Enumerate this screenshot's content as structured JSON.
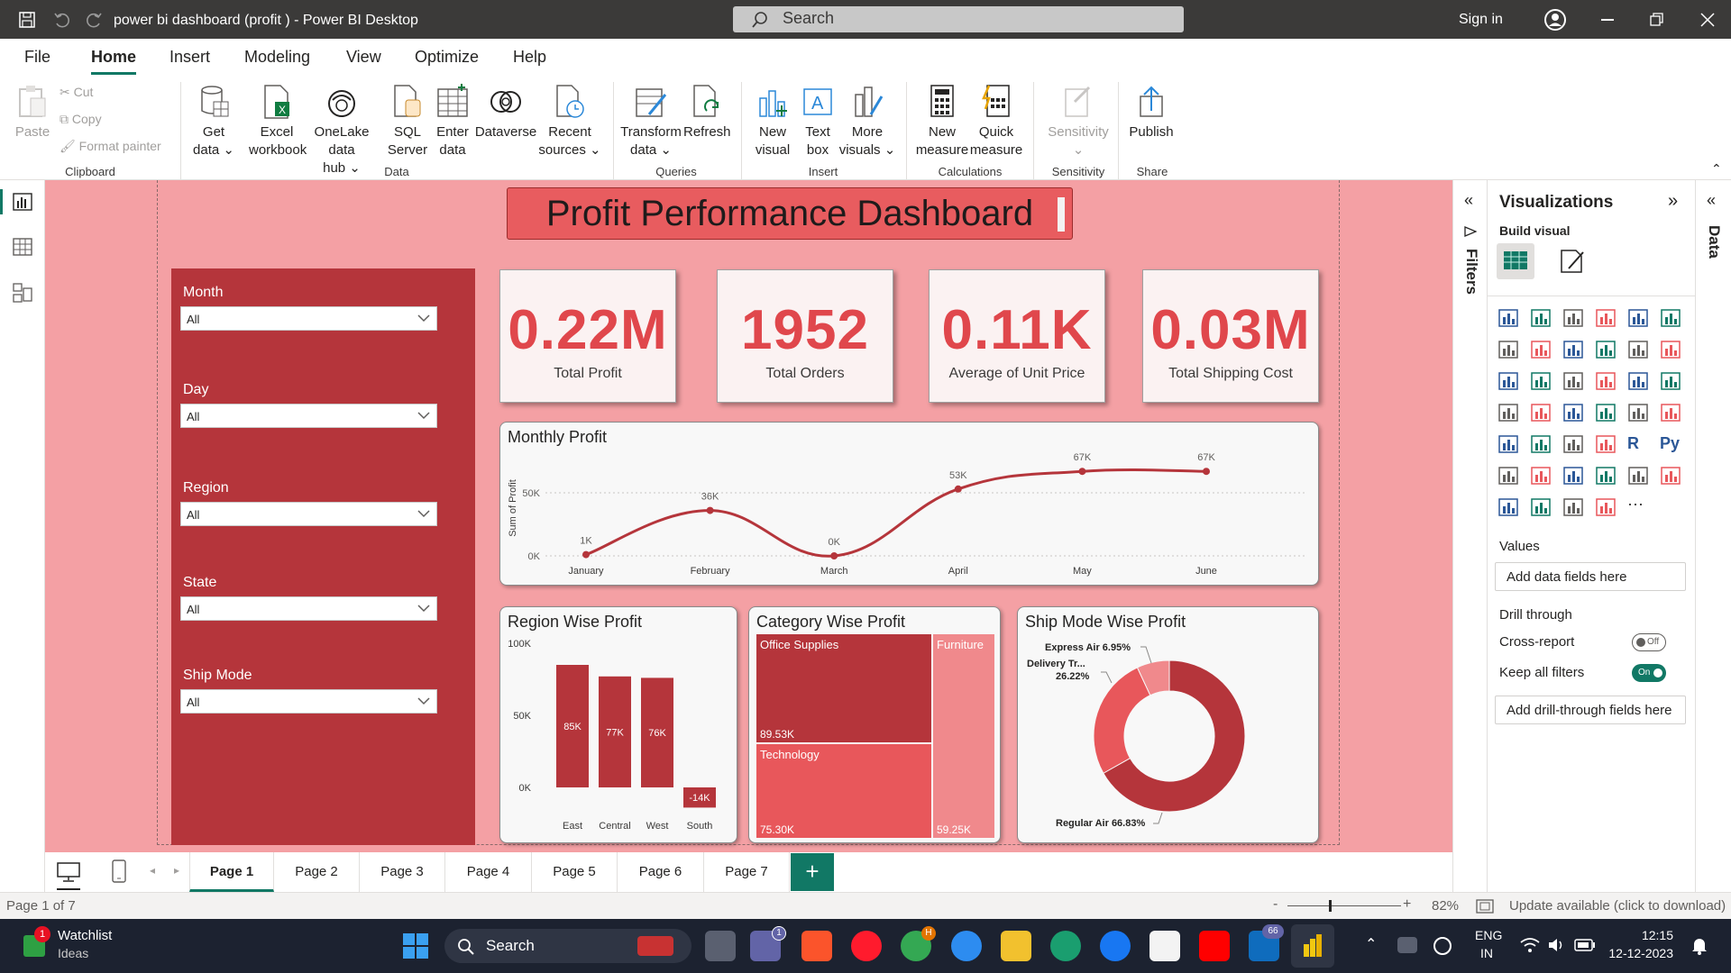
{
  "window": {
    "title": "power bi dashboard (profit ) - Power BI Desktop",
    "search_placeholder": "Search",
    "sign_in": "Sign in"
  },
  "menu": {
    "items": [
      "File",
      "Home",
      "Insert",
      "Modeling",
      "View",
      "Optimize",
      "Help"
    ],
    "active": "Home"
  },
  "ribbon": {
    "clipboard": {
      "paste": "Paste",
      "cut": "Cut",
      "copy": "Copy",
      "format_painter": "Format painter",
      "group": "Clipboard"
    },
    "data": {
      "get_data": [
        "Get",
        "data"
      ],
      "excel": [
        "Excel",
        "workbook"
      ],
      "onelake": [
        "OneLake data",
        "hub"
      ],
      "sql": [
        "SQL",
        "Server"
      ],
      "enter": [
        "Enter",
        "data"
      ],
      "dataverse": "Dataverse",
      "recent": [
        "Recent",
        "sources"
      ],
      "group": "Data"
    },
    "queries": {
      "transform": [
        "Transform",
        "data"
      ],
      "refresh": "Refresh",
      "group": "Queries"
    },
    "insert": {
      "new_visual": [
        "New",
        "visual"
      ],
      "text_box": [
        "Text",
        "box"
      ],
      "more_visuals": [
        "More",
        "visuals"
      ],
      "group": "Insert"
    },
    "calculations": {
      "new_measure": [
        "New",
        "measure"
      ],
      "quick_measure": [
        "Quick",
        "measure"
      ],
      "group": "Calculations"
    },
    "sensitivity": {
      "label": "Sensitivity",
      "group": "Sensitivity"
    },
    "share": {
      "publish": "Publish",
      "group": "Share"
    }
  },
  "dashboard": {
    "title": "Profit Performance Dashboard",
    "slicers": [
      {
        "label": "Month",
        "value": "All"
      },
      {
        "label": "Day",
        "value": "All"
      },
      {
        "label": "Region",
        "value": "All"
      },
      {
        "label": "State",
        "value": "All"
      },
      {
        "label": "Ship Mode",
        "value": "All"
      }
    ],
    "cards": [
      {
        "value": "0.22M",
        "label": "Total Profit"
      },
      {
        "value": "1952",
        "label": "Total Orders"
      },
      {
        "value": "0.11K",
        "label": "Average of Unit Price"
      },
      {
        "value": "0.03M",
        "label": "Total Shipping Cost"
      }
    ],
    "colors": {
      "canvas": "#f4a0a4",
      "accent": "#b5353b",
      "kpi": "#e0474c",
      "line": "#b5353b"
    }
  },
  "chart_data": [
    {
      "type": "line",
      "title": "Monthly Profit",
      "ylabel": "Sum of Profit",
      "categories": [
        "January",
        "February",
        "March",
        "April",
        "May",
        "June"
      ],
      "values": [
        1,
        36,
        0,
        53,
        67,
        67
      ],
      "data_labels": [
        "1K",
        "36K",
        "0K",
        "53K",
        "67K",
        "67K"
      ],
      "yticks": [
        "50K",
        "0K"
      ],
      "ylim": [
        0,
        70
      ],
      "grid": true
    },
    {
      "type": "bar",
      "title": "Region Wise Profit",
      "categories": [
        "East",
        "Central",
        "West",
        "South"
      ],
      "values": [
        85,
        77,
        76,
        -14
      ],
      "data_labels": [
        "85K",
        "77K",
        "76K",
        "-14K"
      ],
      "yticks": [
        "100K",
        "50K",
        "0K"
      ],
      "ylim": [
        -20,
        100
      ]
    },
    {
      "type": "heatmap",
      "title": "Category Wise Profit",
      "items": [
        {
          "name": "Office Supplies",
          "label": "89.53K",
          "value": 89.53
        },
        {
          "name": "Technology",
          "label": "75.30K",
          "value": 75.3
        },
        {
          "name": "Furniture",
          "label": "59.25K",
          "value": 59.25
        }
      ]
    },
    {
      "type": "pie",
      "title": "Ship Mode Wise Profit",
      "slices": [
        {
          "name": "Regular Air",
          "value": 66.83,
          "label": "Regular Air 66.83%",
          "color": "#b5353b"
        },
        {
          "name": "Delivery Tr...",
          "value": 26.22,
          "label": "Delivery Tr... 26.22%",
          "color": "#e8575b"
        },
        {
          "name": "Express Air",
          "value": 6.95,
          "label": "Express Air 6.95%",
          "color": "#f0898c"
        }
      ]
    }
  ],
  "visualizations": {
    "title": "Visualizations",
    "build_visual": "Build visual",
    "values_label": "Values",
    "values_placeholder": "Add data fields here",
    "drill_through": "Drill through",
    "cross_report": "Cross-report",
    "cross_report_state": "Off",
    "keep_all_filters": "Keep all filters",
    "keep_all_filters_state": "On",
    "drill_placeholder": "Add drill-through fields here"
  },
  "side_tabs": {
    "filters": "Filters",
    "data": "Data"
  },
  "pages": {
    "tabs": [
      "Page 1",
      "Page 2",
      "Page 3",
      "Page 4",
      "Page 5",
      "Page 6",
      "Page 7"
    ],
    "active": "Page 1",
    "add": "+"
  },
  "status": {
    "page": "Page 1 of 7",
    "zoom": "82%",
    "update": "Update available (click to download)"
  },
  "taskbar": {
    "widget_title": "Watchlist",
    "widget_sub": "Ideas",
    "widget_badge": "1",
    "search": "Search",
    "teams_badge": "1",
    "chrome_badge": "H",
    "outlook_badge": "66",
    "lang1": "ENG",
    "lang2": "IN",
    "time": "12:15",
    "date": "12-12-2023"
  }
}
